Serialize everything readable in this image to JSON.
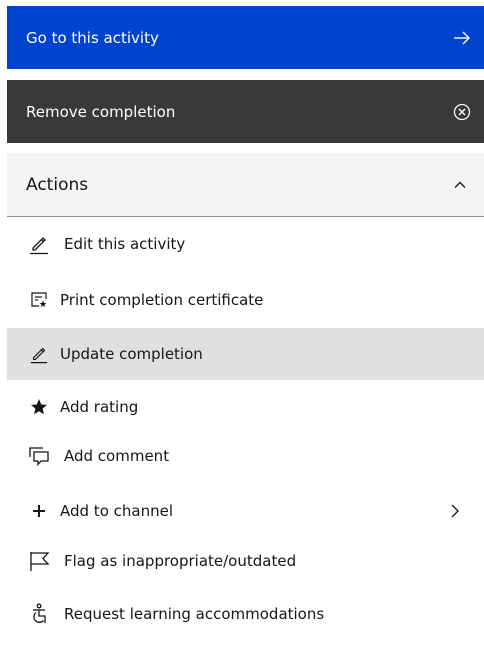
{
  "primary_button": {
    "label": "Go to this activity",
    "icon": "arrow-right-icon"
  },
  "secondary_button": {
    "label": "Remove completion",
    "icon": "close-circle-icon"
  },
  "actions": {
    "title": "Actions",
    "items": [
      {
        "label": "Edit this activity",
        "icon": "edit-icon"
      },
      {
        "label": "Print completion certificate",
        "icon": "certificate-icon"
      },
      {
        "label": "Update completion",
        "icon": "edit-icon",
        "active": true
      },
      {
        "label": "Add rating",
        "icon": "star-icon"
      },
      {
        "label": "Add comment",
        "icon": "comment-icon"
      },
      {
        "label": "Add to channel",
        "icon": "add-icon",
        "has_submenu": true
      },
      {
        "label": "Flag as inappropriate/outdated",
        "icon": "flag-icon"
      },
      {
        "label": "Request learning accommodations",
        "icon": "accessibility-icon"
      }
    ]
  },
  "colors": {
    "primary": "#0043ce",
    "secondary": "#393939",
    "accordion_bg": "#f4f4f4",
    "active_bg": "#e0e0e0",
    "text": "#161616"
  }
}
